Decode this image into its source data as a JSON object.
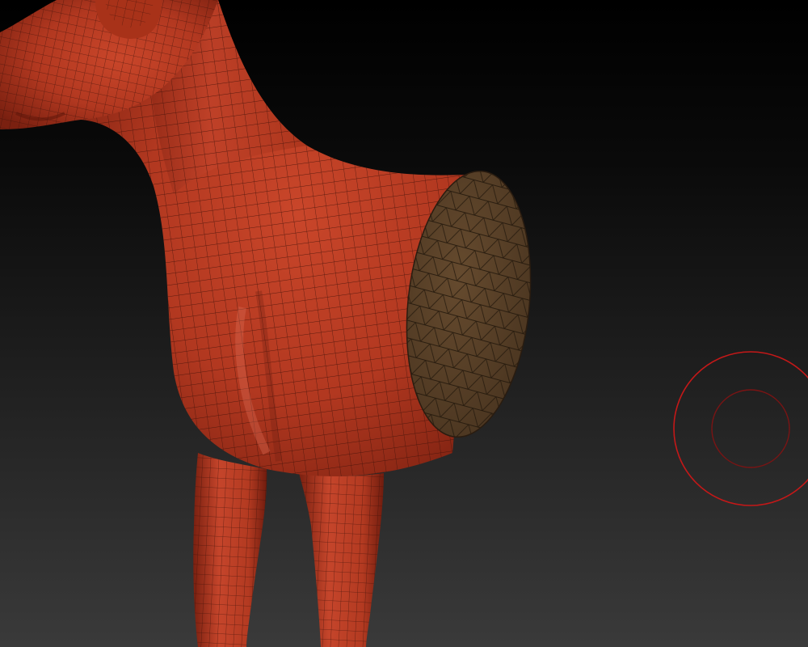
{
  "viewport": {
    "background_top": "#000000",
    "background_bottom": "#3a3a3a"
  },
  "model": {
    "subject": "quadruped-body-mesh",
    "surface_color": "#b73a22",
    "surface_shadow_color": "#6e1d10",
    "wire_color": "#3a1008",
    "cap_color": "#5a4228",
    "cap_wire_color": "#2a1c10",
    "wireframe_visible": true
  },
  "brush_cursor": {
    "outer_ring_color": "#c41818",
    "inner_ring_color": "#7a1414"
  }
}
